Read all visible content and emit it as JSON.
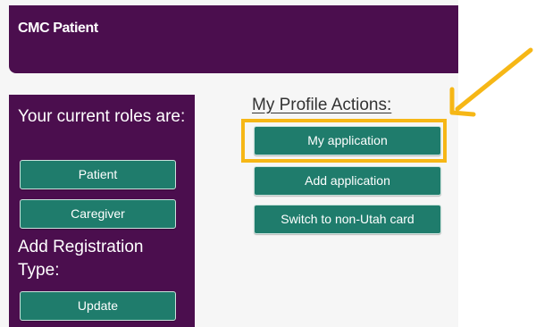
{
  "header": {
    "title": "CMC Patient"
  },
  "roles_panel": {
    "current_roles_heading": "Your current roles are:",
    "roles": [
      {
        "label": "Patient"
      },
      {
        "label": "Caregiver"
      }
    ],
    "add_registration_heading": "Add Registration Type:",
    "update_label": "Update"
  },
  "profile_actions": {
    "heading": "My Profile Actions:",
    "buttons": [
      {
        "label": "My application"
      },
      {
        "label": "Add application"
      },
      {
        "label": "Switch to non-Utah card"
      }
    ]
  },
  "annotation": {
    "highlight_color": "#f6b716",
    "arrow_icon": "arrow-pointer-icon"
  },
  "colors": {
    "brand_purple": "#4b0e4e",
    "button_teal": "#1f7c6c"
  }
}
